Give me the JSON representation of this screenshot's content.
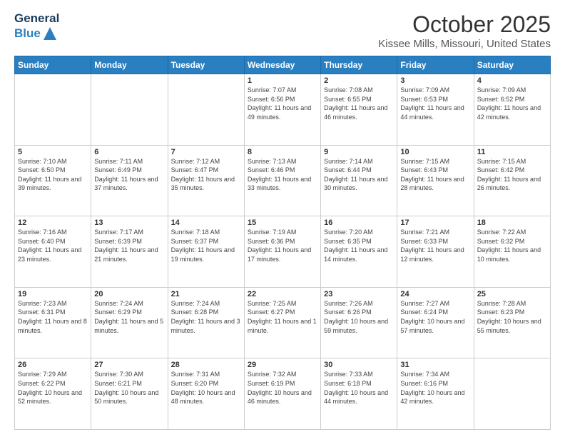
{
  "logo": {
    "general": "General",
    "blue": "Blue"
  },
  "title": {
    "month_year": "October 2025",
    "location": "Kissee Mills, Missouri, United States"
  },
  "weekdays": [
    "Sunday",
    "Monday",
    "Tuesday",
    "Wednesday",
    "Thursday",
    "Friday",
    "Saturday"
  ],
  "weeks": [
    [
      {
        "day": "",
        "info": ""
      },
      {
        "day": "",
        "info": ""
      },
      {
        "day": "",
        "info": ""
      },
      {
        "day": "1",
        "info": "Sunrise: 7:07 AM\nSunset: 6:56 PM\nDaylight: 11 hours and 49 minutes."
      },
      {
        "day": "2",
        "info": "Sunrise: 7:08 AM\nSunset: 6:55 PM\nDaylight: 11 hours and 46 minutes."
      },
      {
        "day": "3",
        "info": "Sunrise: 7:09 AM\nSunset: 6:53 PM\nDaylight: 11 hours and 44 minutes."
      },
      {
        "day": "4",
        "info": "Sunrise: 7:09 AM\nSunset: 6:52 PM\nDaylight: 11 hours and 42 minutes."
      }
    ],
    [
      {
        "day": "5",
        "info": "Sunrise: 7:10 AM\nSunset: 6:50 PM\nDaylight: 11 hours and 39 minutes."
      },
      {
        "day": "6",
        "info": "Sunrise: 7:11 AM\nSunset: 6:49 PM\nDaylight: 11 hours and 37 minutes."
      },
      {
        "day": "7",
        "info": "Sunrise: 7:12 AM\nSunset: 6:47 PM\nDaylight: 11 hours and 35 minutes."
      },
      {
        "day": "8",
        "info": "Sunrise: 7:13 AM\nSunset: 6:46 PM\nDaylight: 11 hours and 33 minutes."
      },
      {
        "day": "9",
        "info": "Sunrise: 7:14 AM\nSunset: 6:44 PM\nDaylight: 11 hours and 30 minutes."
      },
      {
        "day": "10",
        "info": "Sunrise: 7:15 AM\nSunset: 6:43 PM\nDaylight: 11 hours and 28 minutes."
      },
      {
        "day": "11",
        "info": "Sunrise: 7:15 AM\nSunset: 6:42 PM\nDaylight: 11 hours and 26 minutes."
      }
    ],
    [
      {
        "day": "12",
        "info": "Sunrise: 7:16 AM\nSunset: 6:40 PM\nDaylight: 11 hours and 23 minutes."
      },
      {
        "day": "13",
        "info": "Sunrise: 7:17 AM\nSunset: 6:39 PM\nDaylight: 11 hours and 21 minutes."
      },
      {
        "day": "14",
        "info": "Sunrise: 7:18 AM\nSunset: 6:37 PM\nDaylight: 11 hours and 19 minutes."
      },
      {
        "day": "15",
        "info": "Sunrise: 7:19 AM\nSunset: 6:36 PM\nDaylight: 11 hours and 17 minutes."
      },
      {
        "day": "16",
        "info": "Sunrise: 7:20 AM\nSunset: 6:35 PM\nDaylight: 11 hours and 14 minutes."
      },
      {
        "day": "17",
        "info": "Sunrise: 7:21 AM\nSunset: 6:33 PM\nDaylight: 11 hours and 12 minutes."
      },
      {
        "day": "18",
        "info": "Sunrise: 7:22 AM\nSunset: 6:32 PM\nDaylight: 11 hours and 10 minutes."
      }
    ],
    [
      {
        "day": "19",
        "info": "Sunrise: 7:23 AM\nSunset: 6:31 PM\nDaylight: 11 hours and 8 minutes."
      },
      {
        "day": "20",
        "info": "Sunrise: 7:24 AM\nSunset: 6:29 PM\nDaylight: 11 hours and 5 minutes."
      },
      {
        "day": "21",
        "info": "Sunrise: 7:24 AM\nSunset: 6:28 PM\nDaylight: 11 hours and 3 minutes."
      },
      {
        "day": "22",
        "info": "Sunrise: 7:25 AM\nSunset: 6:27 PM\nDaylight: 11 hours and 1 minute."
      },
      {
        "day": "23",
        "info": "Sunrise: 7:26 AM\nSunset: 6:26 PM\nDaylight: 10 hours and 59 minutes."
      },
      {
        "day": "24",
        "info": "Sunrise: 7:27 AM\nSunset: 6:24 PM\nDaylight: 10 hours and 57 minutes."
      },
      {
        "day": "25",
        "info": "Sunrise: 7:28 AM\nSunset: 6:23 PM\nDaylight: 10 hours and 55 minutes."
      }
    ],
    [
      {
        "day": "26",
        "info": "Sunrise: 7:29 AM\nSunset: 6:22 PM\nDaylight: 10 hours and 52 minutes."
      },
      {
        "day": "27",
        "info": "Sunrise: 7:30 AM\nSunset: 6:21 PM\nDaylight: 10 hours and 50 minutes."
      },
      {
        "day": "28",
        "info": "Sunrise: 7:31 AM\nSunset: 6:20 PM\nDaylight: 10 hours and 48 minutes."
      },
      {
        "day": "29",
        "info": "Sunrise: 7:32 AM\nSunset: 6:19 PM\nDaylight: 10 hours and 46 minutes."
      },
      {
        "day": "30",
        "info": "Sunrise: 7:33 AM\nSunset: 6:18 PM\nDaylight: 10 hours and 44 minutes."
      },
      {
        "day": "31",
        "info": "Sunrise: 7:34 AM\nSunset: 6:16 PM\nDaylight: 10 hours and 42 minutes."
      },
      {
        "day": "",
        "info": ""
      }
    ]
  ]
}
